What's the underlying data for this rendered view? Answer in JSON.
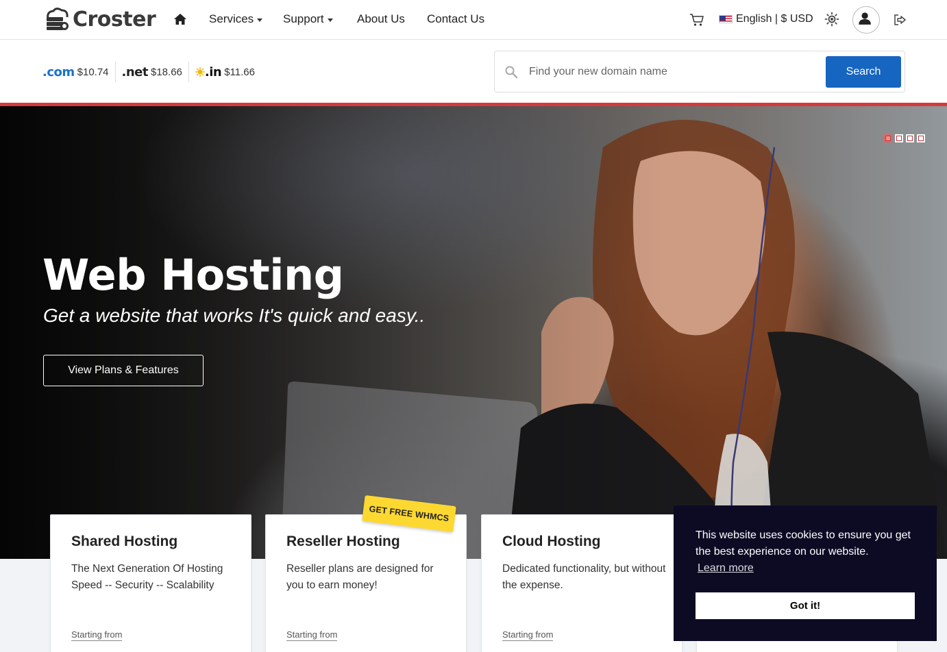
{
  "header": {
    "logo_text": "Croster",
    "nav": {
      "services": "Services",
      "support": "Support",
      "about": "About Us",
      "contact": "Contact Us"
    },
    "language": "English | $ USD"
  },
  "domain_bar": {
    "tlds": [
      {
        "ext": ".com",
        "price": "$10.74"
      },
      {
        "ext": ".net",
        "price": "$18.66"
      },
      {
        "ext": ".in",
        "price": "$11.66"
      }
    ],
    "search": {
      "placeholder": "Find your new domain name",
      "button": "Search"
    }
  },
  "hero": {
    "title": "Web Hosting",
    "subtitle": "Get a website that works It's quick and easy..",
    "button": "View Plans & Features",
    "slides_total": 4,
    "slide_active": 1
  },
  "cards": [
    {
      "title": "Shared Hosting",
      "description": "The Next Generation Of Hosting Speed -- Security -- Scalability",
      "starting": "Starting from"
    },
    {
      "title": "Reseller Hosting",
      "description": "Reseller plans are designed for you to earn money!",
      "starting": "Starting from",
      "ribbon": "GET FREE WHMCS"
    },
    {
      "title": "Cloud Hosting",
      "description": "Dedicated functionality, but without the expense.",
      "starting": "Starting from"
    }
  ],
  "cookie": {
    "message": "This website uses cookies to ensure you get the best experience on our website.",
    "learn_more": "Learn more",
    "accept": "Got it!"
  },
  "colors": {
    "primary": "#1665c1",
    "accent_red": "#d9383a",
    "ribbon_yellow": "#fdd831",
    "cookie_bg": "#0d0b24"
  }
}
